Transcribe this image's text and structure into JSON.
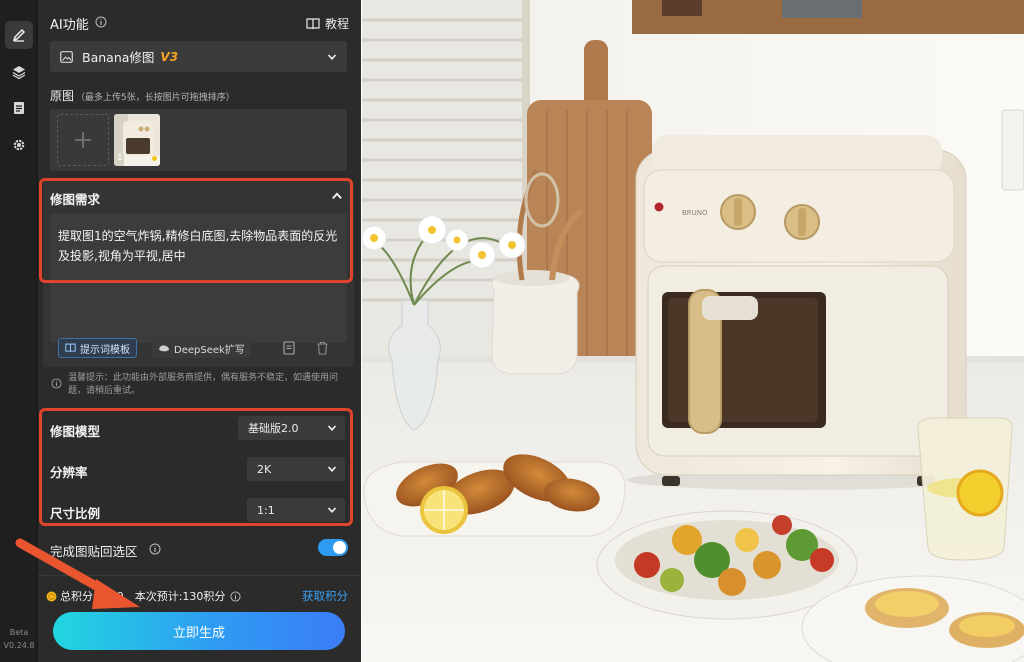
{
  "header": {
    "title": "AI功能",
    "tutorial_label": "教程"
  },
  "feature_select": {
    "label": "Banana修图",
    "version": "V3"
  },
  "source": {
    "label": "原图",
    "hint": "（最多上传5张，长按图片可拖拽排序）",
    "image_index": "1"
  },
  "requirement": {
    "label": "修图需求",
    "text": "提取图1的空气炸锅,精修白底图,去除物品表面的反光及投影,视角为平视,居中"
  },
  "tools": {
    "template_label": "提示词模板",
    "deepseek_label": "DeepSeek扩写"
  },
  "notice": "温馨提示：此功能由外部服务商提供，偶有服务不稳定，如遇使用问题，请稍后重试。",
  "settings": {
    "model": {
      "label": "修图模型",
      "value": "基础版2.0"
    },
    "resolution": {
      "label": "分辨率",
      "value": "2K"
    },
    "ratio": {
      "label": "尺寸比例",
      "value": "1:1"
    }
  },
  "paste_back": {
    "label": "完成图贴回选区",
    "enabled": true
  },
  "points": {
    "total_label": "总积分",
    "total_value": "909",
    "estimate": "本次预计:130积分",
    "get_points_label": "获取积分"
  },
  "generate_label": "立即生成",
  "version": {
    "channel": "Beta",
    "number": "V0.24.8"
  },
  "colors": {
    "accent": "#2d9cf0",
    "highlight": "#e0442d",
    "panel": "#2b2b2b",
    "version_badge": "#f5a623"
  },
  "icons": [
    "brush-icon",
    "layers-icon",
    "document-icon",
    "settings-icon",
    "book-icon",
    "image-icon",
    "chevron-down-icon",
    "chevron-up-icon",
    "plus-icon",
    "info-icon",
    "coin-icon",
    "trash-icon",
    "save-icon"
  ]
}
